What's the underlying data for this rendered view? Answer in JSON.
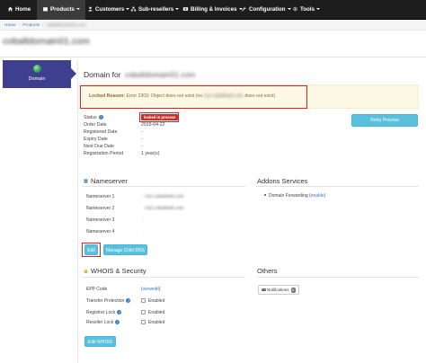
{
  "navbar": {
    "items": [
      {
        "label": "Home",
        "icon": "home-icon"
      },
      {
        "label": "Products",
        "icon": "box-icon"
      },
      {
        "label": "Customers",
        "icon": "users-icon"
      },
      {
        "label": "Sub-resellers",
        "icon": "sitemap-icon"
      },
      {
        "label": "Billing & Invoices",
        "icon": "money-icon"
      },
      {
        "label": "Configuration",
        "icon": "wrench-icon"
      },
      {
        "label": "Tools",
        "icon": "gear-icon"
      }
    ]
  },
  "breadcrumb": {
    "home": "Home",
    "products": "Products",
    "current": "cobaltdomain01.com"
  },
  "page_title": "cobaltdomain01.com",
  "left_tab": {
    "label": "Domain",
    "icon": "globe-icon"
  },
  "domain_heading": {
    "prefix": "Domain for",
    "name": "cobaltdomain01.com"
  },
  "alert": {
    "label": "Locked Reason:",
    "message_start": "Error 2303: Object does not exist (ns",
    "message_hidden": "ns1.cobaltweb.com",
    "message_end": "does not exist)"
  },
  "status": {
    "status_label": "Status",
    "status_badge": "locked in process",
    "order_date_label": "Order Date",
    "order_date": "2015-04-22",
    "registered_label": "Registered Date",
    "registered": "-",
    "expiry_label": "Expiry Date",
    "expiry": "-",
    "next_due_label": "Next Due Date",
    "next_due": "-",
    "period_label": "Registration Period",
    "period": "1 year(s)"
  },
  "retry_button": "Retry Process",
  "nameserver": {
    "heading": "Nameserver",
    "rows": [
      {
        "label": "Nameserver 1",
        "value": ": ns1.cobaltweb.com"
      },
      {
        "label": "Nameserver 2",
        "value": ": ns2.cobaltweb.com"
      },
      {
        "label": "Nameserver 3",
        "value": ":"
      },
      {
        "label": "Nameserver 4",
        "value": ":"
      }
    ],
    "edit_button": "Edit",
    "manage_button": "Manage Child DNS"
  },
  "addons": {
    "heading": "Addons Services",
    "item_label": "Domain Forwarding",
    "item_link": "enable"
  },
  "whois": {
    "heading": "WHOIS & Security",
    "epp_label": "EPP Code",
    "epp_link": "viewedit",
    "transfer_label": "Transfer Protection",
    "registrar_label": "Registrar Lock",
    "reseller_label": "Reseller Lock",
    "enabled_text": "Enabled",
    "edit_button": "Edit WHOIS"
  },
  "others": {
    "heading": "Others",
    "notifications_label": "Notifications",
    "notifications_count": "0"
  },
  "colors": {
    "navbar": "#1d1d1d",
    "left_tab": "#3f3f8f",
    "accent": "#5bc0de",
    "link": "#3a7bbf",
    "alert_bg": "#fcf8e3",
    "danger": "#c9302c",
    "highlight": "#e02020"
  }
}
